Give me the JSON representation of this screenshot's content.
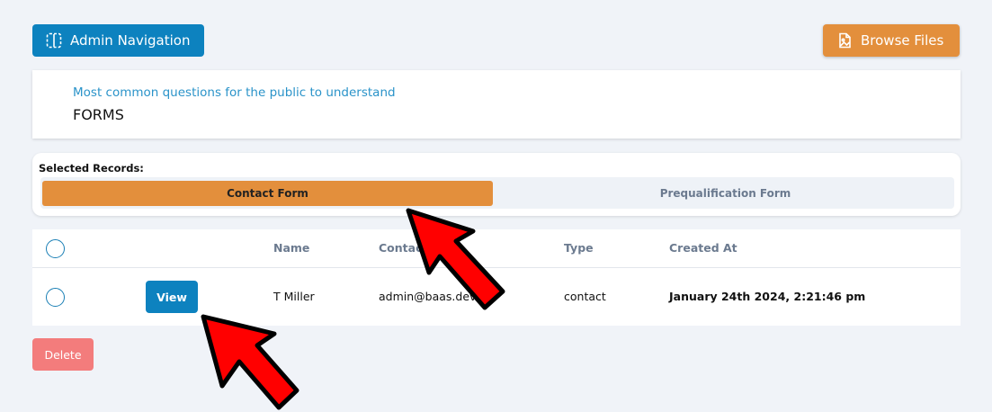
{
  "toolbar": {
    "admin_nav_label": "Admin Navigation",
    "browse_files_label": "Browse Files"
  },
  "header": {
    "subtitle": "Most common questions for the public to understand",
    "title": "FORMS"
  },
  "selected_records": {
    "label": "Selected Records:",
    "tabs": [
      {
        "label": "Contact Form",
        "active": true
      },
      {
        "label": "Prequalification Form",
        "active": false
      }
    ]
  },
  "table": {
    "columns": [
      "",
      "",
      "Name",
      "Contact",
      "Type",
      "Created At"
    ],
    "rows": [
      {
        "action_label": "View",
        "name": "T Miller",
        "contact": "admin@baas.dev",
        "type": "contact",
        "created_at": "January 24th 2024, 2:21:46 pm"
      }
    ]
  },
  "delete_label": "Delete",
  "colors": {
    "primary": "#0d82bf",
    "accent": "#e38f3c",
    "danger": "#f37c7c",
    "annotation_arrow": "#ff0000"
  },
  "icons": [
    "sidebar-toggle-icon",
    "file-image-icon"
  ]
}
